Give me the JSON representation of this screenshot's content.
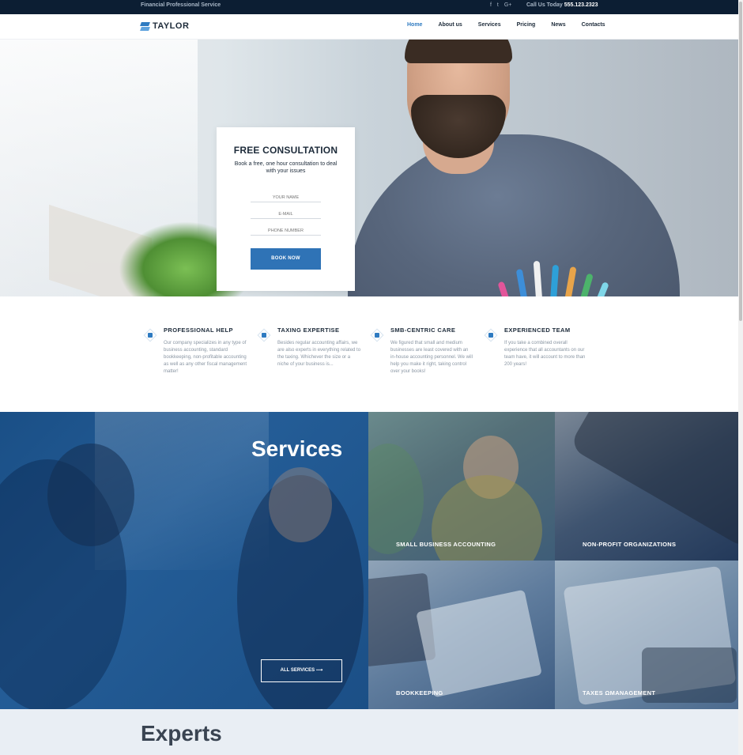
{
  "topbar": {
    "tagline": "Financial Professional Service",
    "social": [
      "f",
      "t",
      "G+"
    ],
    "call_label": "Call Us Today",
    "phone": "555.123.2323"
  },
  "header": {
    "logo": "TAYLOR",
    "nav": [
      "Home",
      "About us",
      "Services",
      "Pricing",
      "News",
      "Contacts"
    ],
    "active": "Home"
  },
  "consultation": {
    "title": "FREE CONSULTATION",
    "subtitle": "Book a free, one hour consultation to deal with your issues",
    "name_placeholder": "YOUR NAME",
    "email_placeholder": "E-MAIL",
    "phone_placeholder": "PHONE NUMBER",
    "button": "BOOK NOW"
  },
  "features": [
    {
      "title": "PROFESSIONAL HELP",
      "text": "Our company specializes in any type of business accounting, standard bookkeeping, non-profitable accounting as well as any other fiscal management matter!"
    },
    {
      "title": "TAXING EXPERTISE",
      "text": "Besides regular accounting affairs, we are also experts in everything related to the taxing. Whichever the size or a niche of your business is..."
    },
    {
      "title": "SMB-CENTRIC CARE",
      "text": "We figured that small and medium businesses are least covered with an in-house accounting personnel. We will help you make it right, taking control over your books!"
    },
    {
      "title": "EXPERIENCED TEAM",
      "text": "If you take a combined overall experience that all accountants on our team have, it will account to more than 200 years!"
    }
  ],
  "services": {
    "heading": "Services",
    "all_button": "ALL SERVICES ⟶",
    "tiles": [
      "SMALL BUSINESS ACCOUNTING",
      "NON-PROFIT ORGANIZATIONS",
      "BOOKKEEPING",
      "TAXES ΩMANAGEMENT"
    ]
  },
  "experts": {
    "heading": "Experts"
  },
  "colors": {
    "accent": "#2f7bc1",
    "dark": "#0c1e33",
    "services_bg": "#1f5690"
  }
}
